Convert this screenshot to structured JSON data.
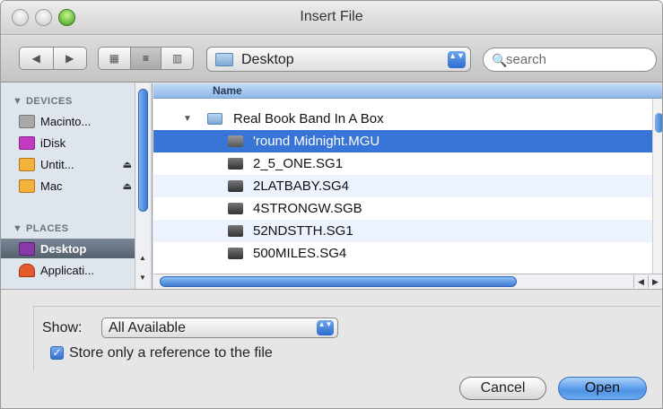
{
  "window": {
    "title": "Insert File"
  },
  "toolbar": {
    "back_glyph": "◀",
    "forward_glyph": "▶",
    "view_icon_glyph": "▦",
    "view_list_glyph": "≡",
    "view_column_glyph": "▥",
    "location": "Desktop",
    "location_arrows": "▲▼",
    "search_placeholder": "search",
    "search_value": "",
    "search_glyph": "🔍"
  },
  "sidebar": {
    "devices_header": "▼ DEVICES",
    "devices": [
      {
        "label": "Macinto...",
        "icon": "hard-drive-icon",
        "color": "#a9a9a9"
      },
      {
        "label": "iDisk",
        "icon": "idisk-icon",
        "color": "#c13cc0"
      },
      {
        "label": "Untit...",
        "icon": "drive-icon",
        "color": "#f2b23b",
        "eject": "⏏"
      },
      {
        "label": "Mac",
        "icon": "drive-icon",
        "color": "#f2b23b",
        "eject": "⏏"
      }
    ],
    "places_header": "▼ PLACES",
    "places": [
      {
        "label": "Desktop",
        "icon": "desktop-icon",
        "color": "#8a3aa8",
        "selected": true
      },
      {
        "label": "Applicati...",
        "icon": "applications-icon",
        "color": "#e45a2a"
      }
    ]
  },
  "file_list": {
    "column_name": "Name",
    "folder": {
      "name": "Real Book Band In A Box",
      "disclosure": "▼"
    },
    "files": [
      {
        "name": "'round Midnight.MGU",
        "selected": true
      },
      {
        "name": "2_5_ONE.SG1"
      },
      {
        "name": "2LATBABY.SG4"
      },
      {
        "name": "4STRONGW.SGB"
      },
      {
        "name": "52NDSTTH.SG1"
      },
      {
        "name": "500MILES.SG4"
      }
    ]
  },
  "options": {
    "show_label": "Show:",
    "show_value": "All Available",
    "show_arrows": "▲▼",
    "reference_checkbox_checked": true,
    "reference_label": "Store only a reference to the file",
    "check_glyph": "✓"
  },
  "buttons": {
    "cancel": "Cancel",
    "open": "Open"
  },
  "colors": {
    "selection": "#3875d7",
    "accent": "#4f93e6"
  }
}
